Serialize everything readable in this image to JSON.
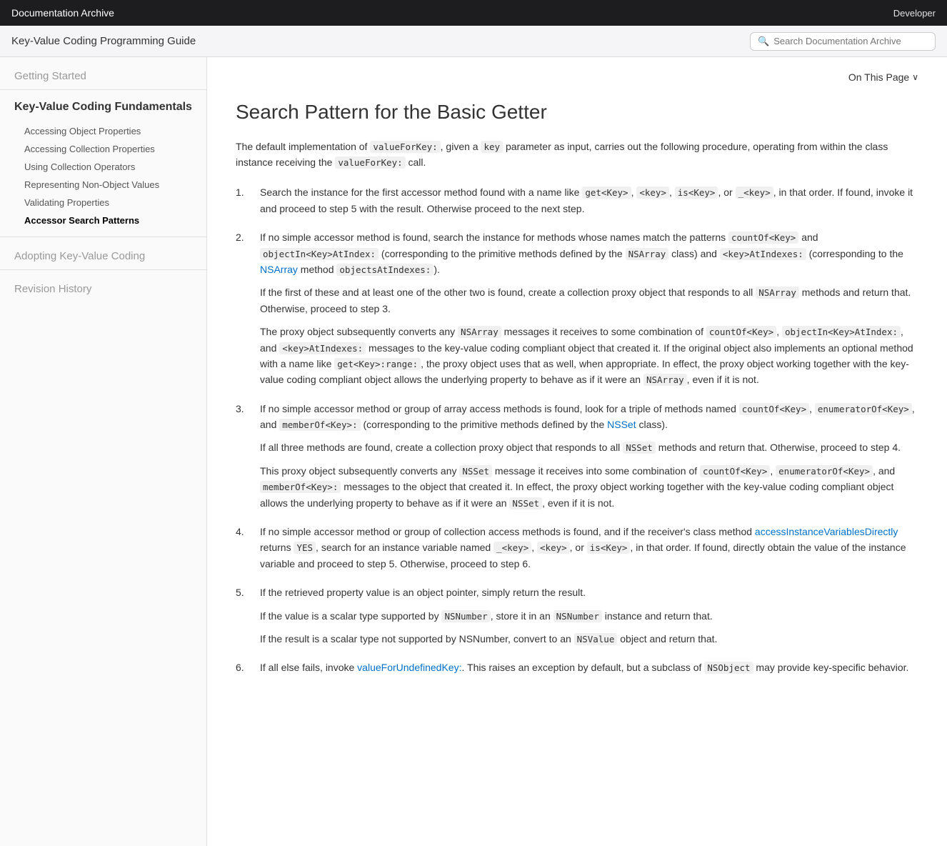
{
  "topbar": {
    "title": "Documentation Archive",
    "developer_label": "Developer",
    "apple_symbol": ""
  },
  "subbar": {
    "title": "Key-Value Coding Programming Guide",
    "search_placeholder": "Search Documentation Archive"
  },
  "sidebar": {
    "getting_started": "Getting Started",
    "kvc_section_title": "Key-Value Coding Fundamentals",
    "kvc_items": [
      {
        "label": "Accessing Object Properties",
        "active": false
      },
      {
        "label": "Accessing Collection Properties",
        "active": false
      },
      {
        "label": "Using Collection Operators",
        "active": false
      },
      {
        "label": "Representing Non-Object Values",
        "active": false
      },
      {
        "label": "Validating Properties",
        "active": false
      },
      {
        "label": "Accessor Search Patterns",
        "active": true
      }
    ],
    "adopting_label": "Adopting Key-Value Coding",
    "revision_label": "Revision History"
  },
  "on_this_page": {
    "label": "On This Page",
    "chevron": "∨"
  },
  "article": {
    "title": "Search Pattern for the Basic Getter",
    "intro": [
      "The default implementation of ",
      "valueForKey:",
      " given a ",
      "key",
      " parameter as input, carries out the following procedure, operating from within the class instance receiving the ",
      "valueForKey:",
      " call."
    ],
    "list_items": [
      {
        "number": 1,
        "paragraphs": [
          {
            "text": "Search the instance for the first accessor method found with a name like ",
            "codes": [
              "get<Key>",
              "<key>",
              "is<Key>"
            ],
            "rest": ", in that order. If found, invoke it and proceed to step 5 with the result. Otherwise proceed to the next step.",
            "has_or": true
          }
        ]
      },
      {
        "number": 2,
        "paragraphs": [
          {
            "prefix": "If no simple accessor method is found, search the instance for methods whose names match the patterns ",
            "codes": [
              "countOf<Key>",
              "objectIn<Key>AtIndex:"
            ],
            "mid": " (corresponding to the primitive methods defined by the ",
            "class1": "NSArray",
            "mid2": " class) and ",
            "code2": "<key>AtIndexes:",
            "mid3": " (corresponding to the ",
            "link1": "NSArray",
            "method1": " method ",
            "code3": "objectsAtIndexes:",
            "suffix": ")."
          },
          {
            "text": "If the first of these and at least one of the other two is found, create a collection proxy object that responds to all ",
            "code": "NSArray",
            "text2": " methods and return that. Otherwise, proceed to step 3."
          },
          {
            "text": "The proxy object subsequently converts any ",
            "code1": "NSArray",
            "text2": " messages it receives to some combination of ",
            "code2": "countOf<Key>",
            "text3": ", ",
            "code3": "objectIn<Key>AtIndex:",
            "text4": ", and ",
            "code4": "<key>AtIndexes:",
            "text5": " messages to the key-value coding compliant object that created it. If the original object also implements an optional method with a name like ",
            "code5": "get<Key>:range:",
            "text6": ", the proxy object uses that as well, when appropriate. In effect, the proxy object working together with the key-value coding compliant object allows the underlying property to behave as if it were an ",
            "code6": "NSArray",
            "text7": ", even if it is not."
          }
        ]
      },
      {
        "number": 3,
        "paragraphs": [
          {
            "text": "If no simple accessor method or group of array access methods is found, look for a triple of methods named ",
            "code1": "countOf<Key>",
            "text2": ", ",
            "code2": "enumeratorOf<Key>",
            "text3": ", and ",
            "code3": "memberOf<Key>:",
            "text4": " (corresponding to the primitive methods defined by the ",
            "link": "NSSet",
            "text5": " class)."
          },
          {
            "text": "If all three methods are found, create a collection proxy object that responds to all ",
            "code": "NSSet",
            "text2": " methods and return that. Otherwise, proceed to step 4."
          },
          {
            "text": "This proxy object subsequently converts any ",
            "code1": "NSSet",
            "text2": " message it receives into some combination of ",
            "code2": "countOf<Key>",
            "text3": ", ",
            "code3": "enumeratorOf<Key>",
            "text4": ", and ",
            "code4": "memberOf<Key>:",
            "text5": " messages to the object that created it. In effect, the proxy object working together with the key-value coding compliant object allows the underlying property to behave as if it were an ",
            "code5": "NSSet",
            "text6": ", even if it is not."
          }
        ]
      },
      {
        "number": 4,
        "paragraphs": [
          {
            "text": "If no simple accessor method or group of collection access methods is found, and if the receiver's class method ",
            "link": "accessInstanceVariablesDirectly",
            "text2": " returns ",
            "code1": "YES",
            "text3": ", search for an instance variable named ",
            "code2": "_<key>",
            "text4": ", ",
            "code3": "<key>",
            "text5": ", or ",
            "code4": "is<Key>",
            "text6": ", in that order. If found, directly obtain the value of the instance variable and proceed to step 5. Otherwise, proceed to step 6."
          }
        ]
      },
      {
        "number": 5,
        "paragraphs": [
          {
            "text": "If the retrieved property value is an object pointer, simply return the result."
          },
          {
            "text": "If the value is a scalar type supported by ",
            "code1": "NSNumber",
            "text2": ", store it in an ",
            "code2": "NSNumber",
            "text3": " instance and return that."
          },
          {
            "text": "If the result is a scalar type not supported by NSNumber, convert to an ",
            "code": "NSValue",
            "text2": " object and return that."
          }
        ]
      },
      {
        "number": 6,
        "paragraphs": [
          {
            "text": "If all else fails, invoke ",
            "link": "valueForUndefinedKey:",
            "text2": ". This raises an exception by default, but a subclass of ",
            "code": "NSObject",
            "text3": " may provide key-specific behavior."
          }
        ]
      }
    ]
  }
}
